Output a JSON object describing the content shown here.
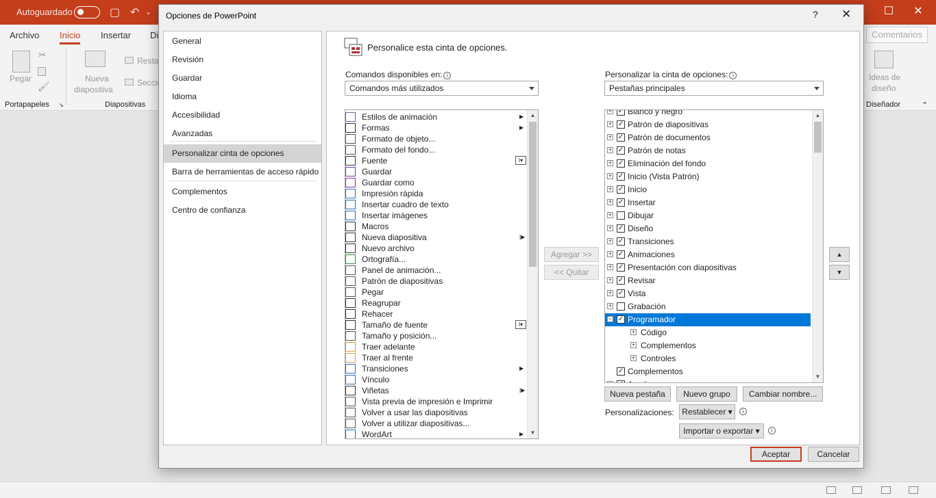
{
  "app": {
    "autosave_label": "Autoguardado",
    "tabs": [
      "Archivo",
      "Inicio",
      "Insertar",
      "Di"
    ],
    "comments_label": "Comentarios",
    "ribbon": {
      "paste": "Pegar",
      "new_slide_1": "Nueva",
      "new_slide_2": "diapositiva",
      "restore": "Restab",
      "section": "Secció",
      "design_ideas_1": "Ideas de",
      "design_ideas_2": "diseño",
      "group_clipboard": "Portapapeles",
      "group_slides": "Diapositivas",
      "group_designer": "Diseñador"
    }
  },
  "dialog": {
    "title": "Opciones de PowerPoint",
    "help": "?",
    "close": "✕",
    "nav": [
      "General",
      "Revisión",
      "Guardar",
      "Idioma",
      "Accesibilidad",
      "Avanzadas",
      "Personalizar cinta de opciones",
      "Barra de herramientas de acceso rápido",
      "Complementos",
      "Centro de confianza"
    ],
    "heading": "Personalice esta cinta de opciones.",
    "commands_label": "Comandos disponibles en:",
    "commands_select": "Comandos más utilizados",
    "customize_label": "Personalizar la cinta de opciones:",
    "customize_select": "Pestañas principales",
    "commands": [
      {
        "label": "Estilos de animación",
        "marker": "▶"
      },
      {
        "label": "Formas",
        "marker": "▶"
      },
      {
        "label": "Formato de objeto...",
        "marker": ""
      },
      {
        "label": "Formato del fondo...",
        "marker": ""
      },
      {
        "label": "Fuente",
        "marker": "I▾"
      },
      {
        "label": "Guardar",
        "marker": ""
      },
      {
        "label": "Guardar como",
        "marker": ""
      },
      {
        "label": "Impresión rápida",
        "marker": ""
      },
      {
        "label": "Insertar cuadro de texto",
        "marker": ""
      },
      {
        "label": "Insertar imágenes",
        "marker": ""
      },
      {
        "label": "Macros",
        "marker": ""
      },
      {
        "label": "Nueva diapositiva",
        "marker": "|▶"
      },
      {
        "label": "Nuevo archivo",
        "marker": ""
      },
      {
        "label": "Ortografía...",
        "marker": ""
      },
      {
        "label": "Panel de animación...",
        "marker": ""
      },
      {
        "label": "Patrón de diapositivas",
        "marker": ""
      },
      {
        "label": "Pegar",
        "marker": ""
      },
      {
        "label": "Reagrupar",
        "marker": ""
      },
      {
        "label": "Rehacer",
        "marker": ""
      },
      {
        "label": "Tamaño de fuente",
        "marker": "I▾"
      },
      {
        "label": "Tamaño y posición...",
        "marker": ""
      },
      {
        "label": "Traer adelante",
        "marker": ""
      },
      {
        "label": "Traer al frente",
        "marker": ""
      },
      {
        "label": "Transiciones",
        "marker": "▶"
      },
      {
        "label": "Vínculo",
        "marker": ""
      },
      {
        "label": "Viñetas",
        "marker": "|▶"
      },
      {
        "label": "Vista previa de impresión e Imprimir",
        "marker": ""
      },
      {
        "label": "Volver a usar las diapositivas",
        "marker": ""
      },
      {
        "label": "Volver a utilizar diapositivas...",
        "marker": ""
      },
      {
        "label": "WordArt",
        "marker": "▶"
      }
    ],
    "add_button": "Agregar >>",
    "remove_button": "<< Quitar",
    "tree": [
      {
        "label": "Blanco y negro",
        "checked": true,
        "level": 0,
        "expander": "+",
        "selected": false
      },
      {
        "label": "Patrón de diapositivas",
        "checked": true,
        "level": 0,
        "expander": "+",
        "selected": false
      },
      {
        "label": "Patrón de documentos",
        "checked": true,
        "level": 0,
        "expander": "+",
        "selected": false
      },
      {
        "label": "Patrón de notas",
        "checked": true,
        "level": 0,
        "expander": "+",
        "selected": false
      },
      {
        "label": "Eliminación del fondo",
        "checked": true,
        "level": 0,
        "expander": "+",
        "selected": false
      },
      {
        "label": "Inicio (Vista Patrón)",
        "checked": true,
        "level": 0,
        "expander": "+",
        "selected": false
      },
      {
        "label": "Inicio",
        "checked": true,
        "level": 0,
        "expander": "+",
        "selected": false
      },
      {
        "label": "Insertar",
        "checked": true,
        "level": 0,
        "expander": "+",
        "selected": false
      },
      {
        "label": "Dibujar",
        "checked": false,
        "level": 0,
        "expander": "+",
        "selected": false
      },
      {
        "label": "Diseño",
        "checked": true,
        "level": 0,
        "expander": "+",
        "selected": false
      },
      {
        "label": "Transiciones",
        "checked": true,
        "level": 0,
        "expander": "+",
        "selected": false
      },
      {
        "label": "Animaciones",
        "checked": true,
        "level": 0,
        "expander": "+",
        "selected": false
      },
      {
        "label": "Presentación con diapositivas",
        "checked": true,
        "level": 0,
        "expander": "+",
        "selected": false
      },
      {
        "label": "Revisar",
        "checked": true,
        "level": 0,
        "expander": "+",
        "selected": false
      },
      {
        "label": "Vista",
        "checked": true,
        "level": 0,
        "expander": "+",
        "selected": false
      },
      {
        "label": "Grabación",
        "checked": false,
        "level": 0,
        "expander": "+",
        "selected": false
      },
      {
        "label": "Programador",
        "checked": true,
        "level": 0,
        "expander": "−",
        "selected": true
      },
      {
        "label": "Código",
        "checked": null,
        "level": 1,
        "expander": "+",
        "selected": false
      },
      {
        "label": "Complementos",
        "checked": null,
        "level": 1,
        "expander": "+",
        "selected": false
      },
      {
        "label": "Controles",
        "checked": null,
        "level": 1,
        "expander": "+",
        "selected": false
      },
      {
        "label": "Complementos",
        "checked": true,
        "level": 0,
        "expander": "",
        "selected": false
      },
      {
        "label": "Ayuda",
        "checked": true,
        "level": 0,
        "expander": "+",
        "selected": false
      }
    ],
    "new_tab_button": "Nueva pestaña",
    "new_group_button": "Nuevo grupo",
    "rename_button": "Cambiar nombre...",
    "customizations_label": "Personalizaciones:",
    "reset_button": "Restablecer ▾",
    "import_export_button": "Importar o exportar ▾",
    "ok_button": "Aceptar",
    "cancel_button": "Cancelar",
    "colors": {
      "accent": "#c43e1c",
      "selection": "#0078d7"
    }
  }
}
